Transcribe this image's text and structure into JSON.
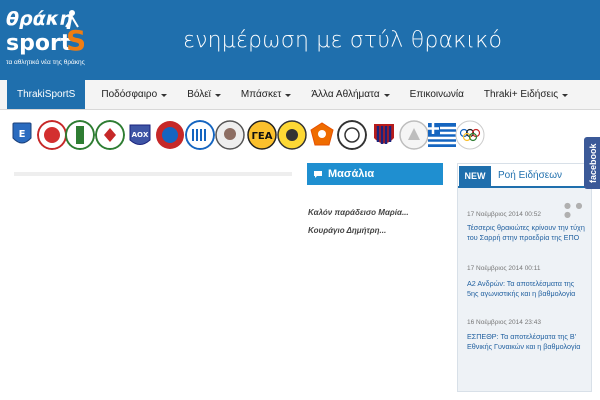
{
  "header": {
    "logo_text": "θράκη SPORTS",
    "logo_subtitle": "τα αθλητικά νέα της θράκης",
    "tagline": "ενημέρωση με στύλ θρακικό",
    "colors": {
      "header_bg": "#1f6fad",
      "logo_orange": "#ef7d12"
    }
  },
  "nav": {
    "items": [
      {
        "label": "ThrakiSportS",
        "active": true,
        "dropdown": false
      },
      {
        "label": "Ποδόσφαιρο",
        "dropdown": true
      },
      {
        "label": "Βόλεϊ",
        "dropdown": true
      },
      {
        "label": "Μπάσκετ",
        "dropdown": true
      },
      {
        "label": "Άλλα Αθλήματα",
        "dropdown": true
      },
      {
        "label": "Επικοινωνία",
        "dropdown": false
      },
      {
        "label": "Thraki+ Ειδήσεις",
        "dropdown": true
      }
    ]
  },
  "badges": [
    {
      "name": "club-badge-1",
      "icon": "club-crest"
    },
    {
      "name": "club-badge-2",
      "icon": "club-crest"
    },
    {
      "name": "club-badge-3",
      "icon": "club-crest"
    },
    {
      "name": "club-badge-4",
      "icon": "club-crest"
    },
    {
      "name": "club-badge-5",
      "icon": "club-crest"
    },
    {
      "name": "club-badge-6",
      "icon": "club-crest"
    },
    {
      "name": "club-badge-7",
      "icon": "club-crest"
    },
    {
      "name": "club-badge-8",
      "icon": "club-crest"
    },
    {
      "name": "club-badge-gea",
      "icon": "club-crest"
    },
    {
      "name": "club-badge-10",
      "icon": "club-crest"
    },
    {
      "name": "club-badge-11",
      "icon": "club-crest"
    },
    {
      "name": "club-badge-12",
      "icon": "club-crest"
    },
    {
      "name": "club-badge-13",
      "icon": "club-crest"
    },
    {
      "name": "club-badge-14",
      "icon": "club-crest"
    },
    {
      "name": "greek-flag-badge",
      "icon": "flag-icon"
    },
    {
      "name": "olympic-rings-badge",
      "icon": "olympic-rings-icon"
    }
  ],
  "masalia": {
    "title": "Μασάλια",
    "icon": "chat-bubble-icon",
    "items": [
      "Καλόν παράδεισο Μαρία...",
      "Κουράγιο Δημήτρη..."
    ]
  },
  "news": {
    "new_label": "NEW",
    "title": "Ροή Ειδήσεων",
    "more": "● ● ●",
    "items": [
      {
        "time": "17 Νοέμβριος 2014 00:52",
        "title": "Τέσσερις θρακιώτες κρίνουν την τύχη του Σαρρή στην προεδρία της ΕΠΟ"
      },
      {
        "time": "17 Νοέμβριος 2014 00:11",
        "title": "Α2 Ανδρών: Τα αποτελέσματα της 5ης αγωνιστικής και η βαθμολογία"
      },
      {
        "time": "16 Νοέμβριος 2014 23:43",
        "title": "ΕΣΠΕΘΡ: Τα αποτελέσματα της Β' Εθνικής Γυναικών και η βαθμολογία"
      }
    ]
  },
  "facebook": {
    "label": "facebook",
    "color": "#3b5998"
  }
}
